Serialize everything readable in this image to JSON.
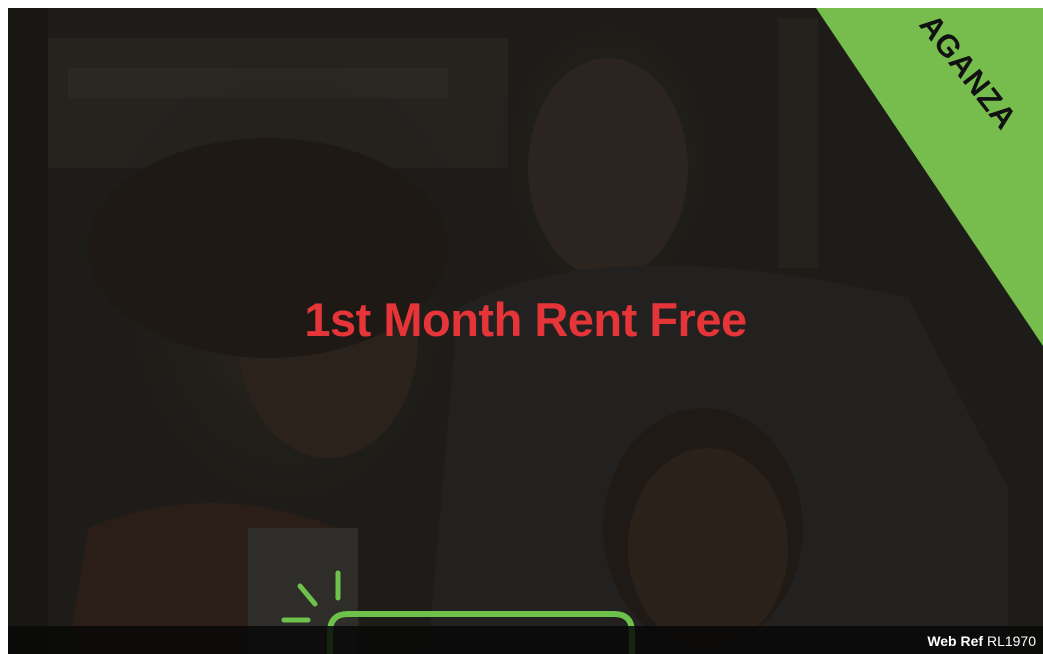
{
  "headline": "1st Month Rent Free",
  "ribbon": {
    "text": "AGANZA"
  },
  "footer": {
    "ref_label": "Web Ref",
    "ref_code": "RL1970"
  },
  "colors": {
    "headline": "#e63538",
    "ribbon": "#77bd4e",
    "cta_outline": "#6cc24a",
    "overlay": "#1c1b17"
  },
  "icons": [
    "sparkle-icon"
  ]
}
